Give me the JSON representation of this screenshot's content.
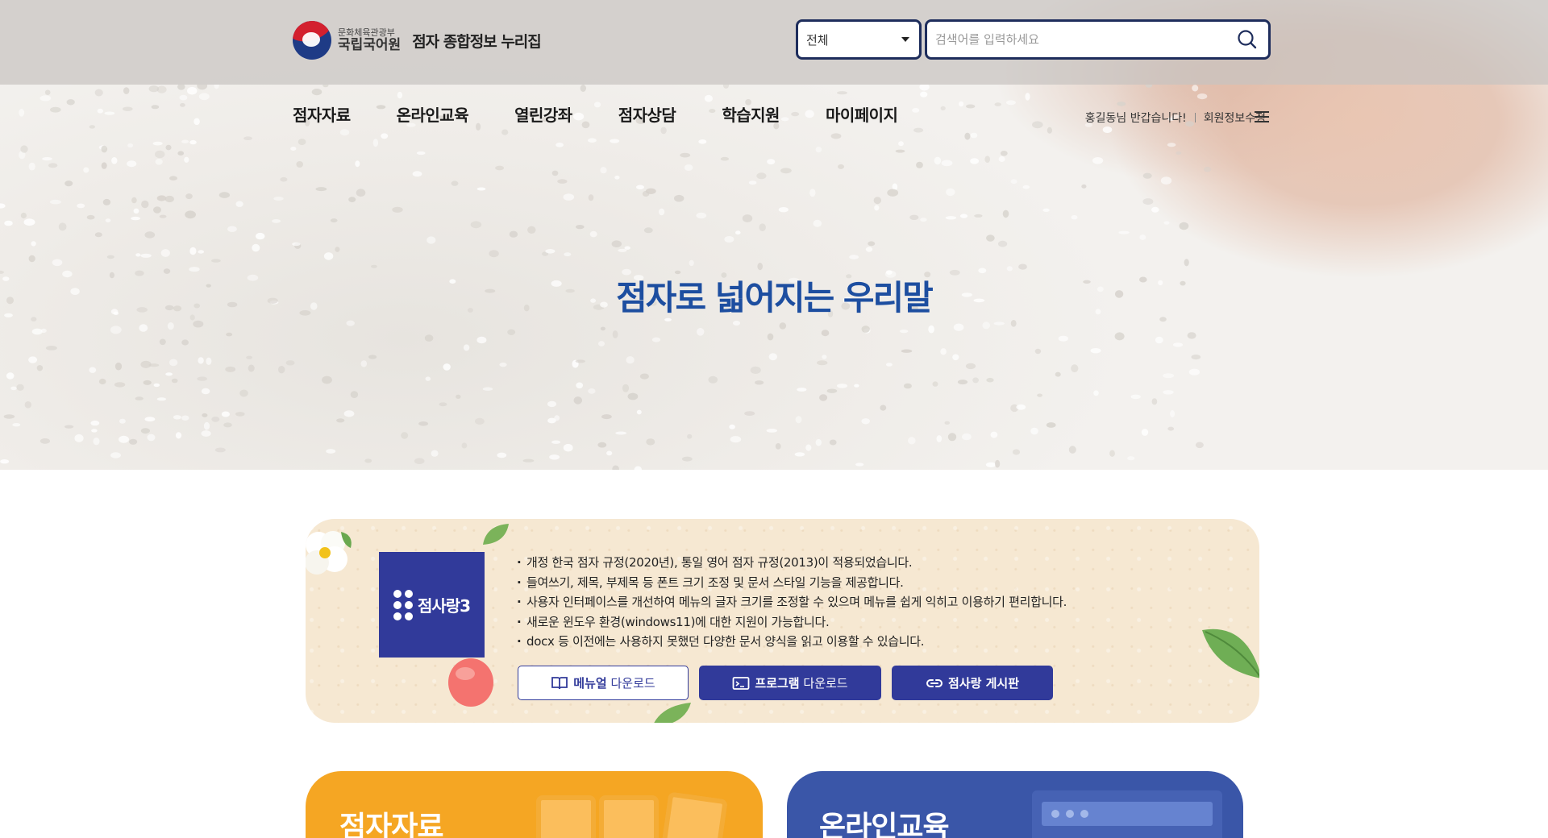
{
  "header": {
    "ministry": "문화체육관광부",
    "institute": "국립국어원",
    "site_name": "점자 종합정보 누리집"
  },
  "search": {
    "category_selected": "전체",
    "placeholder": "검색어를 입력하세요"
  },
  "nav": {
    "items": [
      {
        "label": "점자자료"
      },
      {
        "label": "온라인교육"
      },
      {
        "label": "열린강좌"
      },
      {
        "label": "점자상담"
      },
      {
        "label": "학습지원"
      },
      {
        "label": "마이페이지"
      }
    ]
  },
  "user": {
    "greeting": "홍길동님 반갑습니다!",
    "edit_profile": "회원정보수정"
  },
  "hero": {
    "title": "점자로 넓어지는 우리말"
  },
  "notice": {
    "product_name": "점사랑3",
    "features": [
      "개정 한국 점자 규정(2020년), 통일 영어 점자 규정(2013)이 적용되었습니다.",
      "들여쓰기, 제목, 부제목 등 폰트 크기 조정 및 문서 스타일 기능을 제공합니다.",
      "사용자 인터페이스를 개선하여 메뉴의 글자 크기를 조정할 수 있으며 메뉴를 쉽게 익히고 이용하기 편리합니다.",
      "새로운 윈도우 환경(windows11)에 대한 지원이 가능합니다.",
      "docx 등 이전에는 사용하지 못했던 다양한 문서 양식을 읽고 이용할 수 있습니다."
    ],
    "buttons": {
      "manual_strong": "메뉴얼",
      "manual_rest": "다운로드",
      "program_strong": "프로그램",
      "program_rest": "다운로드",
      "board_strong": "점사랑 게시판"
    }
  },
  "cards": [
    {
      "title": "점자자료",
      "color": "#f5a623"
    },
    {
      "title": "온라인교육",
      "color": "#3a56a8"
    }
  ],
  "colors": {
    "primary": "#313a9a",
    "hero_title": "#1d4ea0",
    "search_border": "#1e2d5c"
  }
}
